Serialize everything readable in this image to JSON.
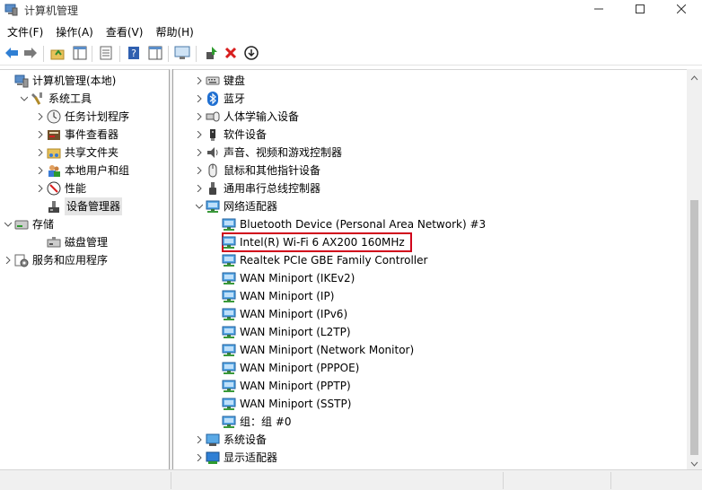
{
  "window": {
    "title": "计算机管理",
    "app_icon": "computer-management-icon",
    "controls": [
      "minimize-icon",
      "maximize-icon",
      "close-icon"
    ]
  },
  "menu": [
    {
      "label": "文件(F)"
    },
    {
      "label": "操作(A)"
    },
    {
      "label": "查看(V)"
    },
    {
      "label": "帮助(H)"
    }
  ],
  "toolbar": [
    "back-icon",
    "forward-icon",
    "up-folder-icon",
    "show-hide-tree-icon",
    "properties-icon",
    "help-icon",
    "action-pane-icon",
    "monitor-icon",
    "update-driver-icon",
    "uninstall-icon",
    "download-icon"
  ],
  "left_tree": [
    {
      "label": "计算机管理(本地)",
      "icon": "computer-management-icon",
      "level": 0,
      "chevron": "none"
    },
    {
      "label": "系统工具",
      "icon": "tools-icon",
      "level": 1,
      "chevron": "down"
    },
    {
      "label": "任务计划程序",
      "icon": "clock-icon",
      "level": 2,
      "chevron": "right"
    },
    {
      "label": "事件查看器",
      "icon": "event-viewer-icon",
      "level": 2,
      "chevron": "right"
    },
    {
      "label": "共享文件夹",
      "icon": "shared-folder-icon",
      "level": 2,
      "chevron": "right"
    },
    {
      "label": "本地用户和组",
      "icon": "users-icon",
      "level": 2,
      "chevron": "right"
    },
    {
      "label": "性能",
      "icon": "performance-icon",
      "level": 2,
      "chevron": "right"
    },
    {
      "label": "设备管理器",
      "icon": "device-manager-icon",
      "level": 2,
      "chevron": "none",
      "selected": true
    },
    {
      "label": "存储",
      "icon": "storage-icon",
      "level": 0,
      "chevron": "down"
    },
    {
      "label": "磁盘管理",
      "icon": "disk-icon",
      "level": 2,
      "chevron": "none"
    },
    {
      "label": "服务和应用程序",
      "icon": "services-icon",
      "level": 0,
      "chevron": "right"
    }
  ],
  "right_tree": [
    {
      "label": "键盘",
      "icon": "keyboard-icon",
      "level": 0,
      "chevron": "right"
    },
    {
      "label": "蓝牙",
      "icon": "bluetooth-icon",
      "level": 0,
      "chevron": "right"
    },
    {
      "label": "人体学输入设备",
      "icon": "hid-icon",
      "level": 0,
      "chevron": "right"
    },
    {
      "label": "软件设备",
      "icon": "software-device-icon",
      "level": 0,
      "chevron": "right"
    },
    {
      "label": "声音、视频和游戏控制器",
      "icon": "speaker-icon",
      "level": 0,
      "chevron": "right"
    },
    {
      "label": "鼠标和其他指针设备",
      "icon": "mouse-icon",
      "level": 0,
      "chevron": "right"
    },
    {
      "label": "通用串行总线控制器",
      "icon": "usb-icon",
      "level": 0,
      "chevron": "right"
    },
    {
      "label": "网络适配器",
      "icon": "network-adapter-icon",
      "level": 0,
      "chevron": "down"
    },
    {
      "label": "Bluetooth Device (Personal Area Network) #3",
      "icon": "network-adapter-icon",
      "level": 1,
      "chevron": "none"
    },
    {
      "label": "Intel(R) Wi-Fi 6 AX200 160MHz",
      "icon": "network-adapter-icon",
      "level": 1,
      "chevron": "none",
      "highlighted": true
    },
    {
      "label": "Realtek PCIe GBE Family Controller",
      "icon": "network-adapter-icon",
      "level": 1,
      "chevron": "none"
    },
    {
      "label": "WAN Miniport (IKEv2)",
      "icon": "network-adapter-icon",
      "level": 1,
      "chevron": "none"
    },
    {
      "label": "WAN Miniport (IP)",
      "icon": "network-adapter-icon",
      "level": 1,
      "chevron": "none"
    },
    {
      "label": "WAN Miniport (IPv6)",
      "icon": "network-adapter-icon",
      "level": 1,
      "chevron": "none"
    },
    {
      "label": "WAN Miniport (L2TP)",
      "icon": "network-adapter-icon",
      "level": 1,
      "chevron": "none"
    },
    {
      "label": "WAN Miniport (Network Monitor)",
      "icon": "network-adapter-icon",
      "level": 1,
      "chevron": "none"
    },
    {
      "label": "WAN Miniport (PPPOE)",
      "icon": "network-adapter-icon",
      "level": 1,
      "chevron": "none"
    },
    {
      "label": "WAN Miniport (PPTP)",
      "icon": "network-adapter-icon",
      "level": 1,
      "chevron": "none"
    },
    {
      "label": "WAN Miniport (SSTP)",
      "icon": "network-adapter-icon",
      "level": 1,
      "chevron": "none"
    },
    {
      "label": "组：组 #0",
      "icon": "network-adapter-icon",
      "level": 1,
      "chevron": "none"
    },
    {
      "label": "系统设备",
      "icon": "system-device-icon",
      "level": 0,
      "chevron": "right"
    },
    {
      "label": "显示适配器",
      "icon": "display-adapter-icon",
      "level": 0,
      "chevron": "right"
    }
  ],
  "colors": {
    "highlight_box": "#d0021b",
    "selection": "#e5e5e5",
    "chevron": "#555555"
  }
}
